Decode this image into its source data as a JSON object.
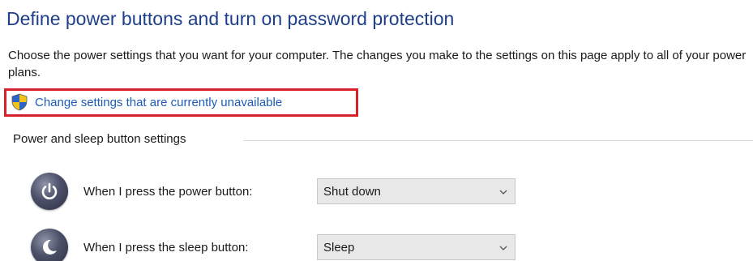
{
  "header": {
    "title": "Define power buttons and turn on password protection",
    "description": "Choose the power settings that you want for your computer. The changes you make to the settings on this page apply to all of your power plans."
  },
  "admin_link": {
    "icon": "uac-shield-icon",
    "label": "Change settings that are currently unavailable",
    "highlight_color": "#d8202a"
  },
  "power_sleep_group": {
    "label": "Power and sleep button settings",
    "rows": [
      {
        "icon": "power-icon",
        "label": "When I press the power button:",
        "selected": "Shut down"
      },
      {
        "icon": "sleep-moon-icon",
        "label": "When I press the sleep button:",
        "selected": "Sleep"
      }
    ]
  },
  "colors": {
    "title": "#1e3f8a",
    "link": "#1c5bb5",
    "dropdown_bg": "#e8e8e8"
  }
}
